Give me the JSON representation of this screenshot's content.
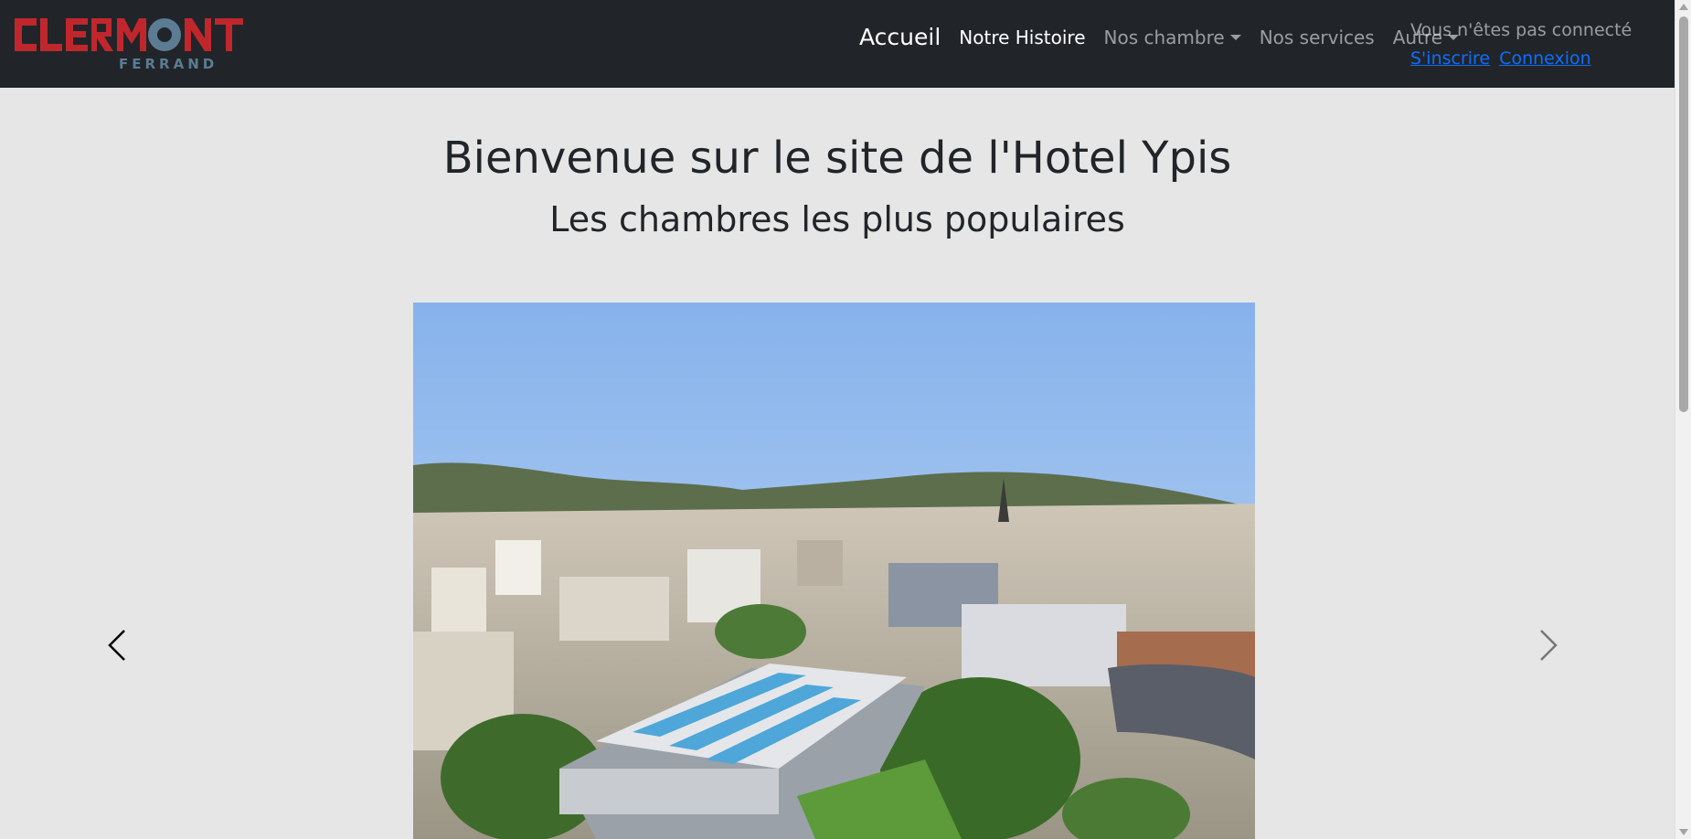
{
  "logo": {
    "word": "CLERMONT",
    "sub": "FERRAND"
  },
  "nav": {
    "home": "Accueil",
    "history": "Notre Histoire",
    "rooms": "Nos chambre",
    "services": "Nos services",
    "other": "Autre"
  },
  "account": {
    "status": "Vous n'êtes pas connecté",
    "signup": "S'inscrire",
    "login": "Connexion"
  },
  "main": {
    "title": "Bienvenue sur le site de l'Hotel Ypis",
    "subtitle": "Les chambres les plus populaires"
  },
  "colors": {
    "navbar_bg": "#212529",
    "page_bg": "#e6e6e6",
    "link": "#0d6efd",
    "logo_red": "#c0272d",
    "logo_steel": "#5b7c93"
  },
  "icons": {
    "prev": "chevron-left-icon",
    "next": "chevron-right-icon",
    "caret": "caret-down-icon"
  }
}
